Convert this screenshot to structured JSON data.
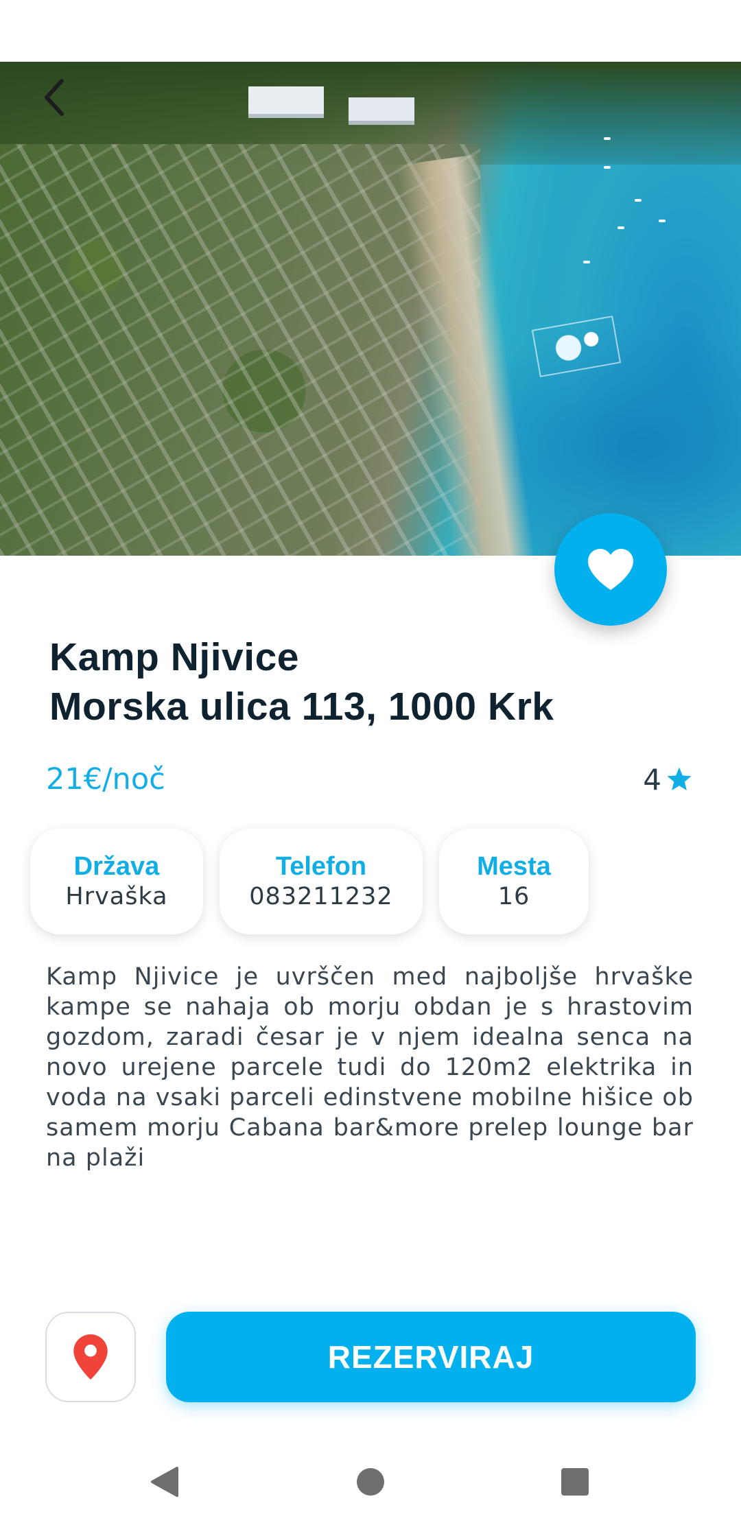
{
  "camp": {
    "name": "Kamp Njivice",
    "address": "Morska ulica 113, 1000 Krk",
    "price": "21€/noč",
    "rating": "4",
    "description": "Kamp Njivice je uvrščen med najboljše hrvaške kampe se nahaja ob morju obdan je s hrastovim gozdom, zaradi česar je v njem idealna senca na novo urejene parcele tudi do 120m2 elektrika in voda na vsaki parceli edinstvene mobilne hišice ob samem morju Cabana bar&more prelep lounge bar na plaži"
  },
  "info_chips": [
    {
      "label": "Država",
      "value": "Hrvaška"
    },
    {
      "label": "Telefon",
      "value": "083211232"
    },
    {
      "label": "Mesta",
      "value": "16"
    }
  ],
  "actions": {
    "reserve_label": "REZERVIRAJ",
    "map_icon": "location-pin-icon",
    "favorite_icon": "heart-icon",
    "back_icon": "chevron-left-icon"
  },
  "colors": {
    "accent": "#03b0ee",
    "title": "#0f2230",
    "pin": "#f0433a"
  }
}
